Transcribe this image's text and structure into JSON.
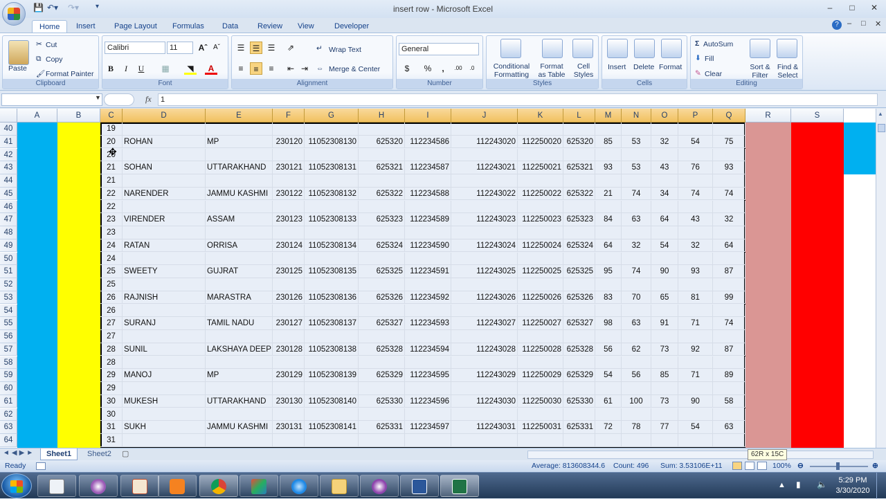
{
  "window": {
    "title": "insert row - Microsoft Excel"
  },
  "ribbon_tabs": [
    "Home",
    "Insert",
    "Page Layout",
    "Formulas",
    "Data",
    "Review",
    "View",
    "Developer"
  ],
  "clipboard": {
    "paste": "Paste",
    "cut": "Cut",
    "copy": "Copy",
    "format_painter": "Format Painter",
    "label": "Clipboard"
  },
  "font": {
    "name": "Calibri",
    "size": "11",
    "label": "Font",
    "bold": "B",
    "italic": "I",
    "underline": "U"
  },
  "alignment": {
    "wrap_text": "Wrap Text",
    "merge_center": "Merge & Center",
    "label": "Alignment"
  },
  "number": {
    "format": "General",
    "label": "Number",
    "currency": "$",
    "percent": "%",
    "comma": ","
  },
  "styles": {
    "conditional": "Conditional",
    "formatting": "Formatting",
    "format_as": "Format",
    "as_table": "as Table",
    "cell": "Cell",
    "styles_word": "Styles",
    "label": "Styles"
  },
  "cells": {
    "insert": "Insert",
    "delete": "Delete",
    "format": "Format",
    "label": "Cells"
  },
  "editing": {
    "autosum": "AutoSum",
    "fill": "Fill",
    "clear": "Clear",
    "sort": "Sort &",
    "filter": "Filter",
    "find": "Find &",
    "select": "Select",
    "label": "Editing"
  },
  "formula_bar": {
    "fx": "fx",
    "value": "1"
  },
  "columns": [
    "A",
    "B",
    "C",
    "D",
    "E",
    "F",
    "G",
    "H",
    "I",
    "J",
    "K",
    "L",
    "M",
    "N",
    "O",
    "P",
    "Q",
    "R",
    "S"
  ],
  "rows": [
    {
      "n": "40",
      "c": "19"
    },
    {
      "n": "41",
      "c": "20",
      "d": "ROHAN",
      "e": "MP",
      "f": "230120",
      "g": "11052308130",
      "h": "625320",
      "i": "112234586",
      "j": "112243020",
      "k": "112250020",
      "l": "625320",
      "m": "85",
      "nn": "53",
      "o": "32",
      "p": "54",
      "q": "75"
    },
    {
      "n": "42",
      "c": "20"
    },
    {
      "n": "43",
      "c": "21",
      "d": "SOHAN",
      "e": "UTTARAKHAND",
      "f": "230121",
      "g": "11052308131",
      "h": "625321",
      "i": "112234587",
      "j": "112243021",
      "k": "112250021",
      "l": "625321",
      "m": "93",
      "nn": "53",
      "o": "43",
      "p": "76",
      "q": "93"
    },
    {
      "n": "44",
      "c": "21"
    },
    {
      "n": "45",
      "c": "22",
      "d": "NARENDER",
      "e": "JAMMU KASHMI",
      "f": "230122",
      "g": "11052308132",
      "h": "625322",
      "i": "112234588",
      "j": "112243022",
      "k": "112250022",
      "l": "625322",
      "m": "21",
      "nn": "74",
      "o": "34",
      "p": "74",
      "q": "74"
    },
    {
      "n": "46",
      "c": "22"
    },
    {
      "n": "47",
      "c": "23",
      "d": "VIRENDER",
      "e": "ASSAM",
      "f": "230123",
      "g": "11052308133",
      "h": "625323",
      "i": "112234589",
      "j": "112243023",
      "k": "112250023",
      "l": "625323",
      "m": "84",
      "nn": "63",
      "o": "64",
      "p": "43",
      "q": "32"
    },
    {
      "n": "48",
      "c": "23"
    },
    {
      "n": "49",
      "c": "24",
      "d": "RATAN",
      "e": "ORRISA",
      "f": "230124",
      "g": "11052308134",
      "h": "625324",
      "i": "112234590",
      "j": "112243024",
      "k": "112250024",
      "l": "625324",
      "m": "64",
      "nn": "32",
      "o": "54",
      "p": "32",
      "q": "64"
    },
    {
      "n": "50",
      "c": "24"
    },
    {
      "n": "51",
      "c": "25",
      "d": "SWEETY",
      "e": "GUJRAT",
      "f": "230125",
      "g": "11052308135",
      "h": "625325",
      "i": "112234591",
      "j": "112243025",
      "k": "112250025",
      "l": "625325",
      "m": "95",
      "nn": "74",
      "o": "90",
      "p": "93",
      "q": "87"
    },
    {
      "n": "52",
      "c": "25"
    },
    {
      "n": "53",
      "c": "26",
      "d": "RAJNISH",
      "e": "MARASTRA",
      "f": "230126",
      "g": "11052308136",
      "h": "625326",
      "i": "112234592",
      "j": "112243026",
      "k": "112250026",
      "l": "625326",
      "m": "83",
      "nn": "70",
      "o": "65",
      "p": "81",
      "q": "99"
    },
    {
      "n": "54",
      "c": "26"
    },
    {
      "n": "55",
      "c": "27",
      "d": "SURANJ",
      "e": "TAMIL NADU",
      "f": "230127",
      "g": "11052308137",
      "h": "625327",
      "i": "112234593",
      "j": "112243027",
      "k": "112250027",
      "l": "625327",
      "m": "98",
      "nn": "63",
      "o": "91",
      "p": "71",
      "q": "74"
    },
    {
      "n": "56",
      "c": "27"
    },
    {
      "n": "57",
      "c": "28",
      "d": "SUNIL",
      "e": "LAKSHAYA DEEP",
      "f": "230128",
      "g": "11052308138",
      "h": "625328",
      "i": "112234594",
      "j": "112243028",
      "k": "112250028",
      "l": "625328",
      "m": "56",
      "nn": "62",
      "o": "73",
      "p": "92",
      "q": "87"
    },
    {
      "n": "58",
      "c": "28"
    },
    {
      "n": "59",
      "c": "29",
      "d": "MANOJ",
      "e": "MP",
      "f": "230129",
      "g": "11052308139",
      "h": "625329",
      "i": "112234595",
      "j": "112243029",
      "k": "112250029",
      "l": "625329",
      "m": "54",
      "nn": "56",
      "o": "85",
      "p": "71",
      "q": "89"
    },
    {
      "n": "60",
      "c": "29"
    },
    {
      "n": "61",
      "c": "30",
      "d": "MUKESH",
      "e": "UTTARAKHAND",
      "f": "230130",
      "g": "11052308140",
      "h": "625330",
      "i": "112234596",
      "j": "112243030",
      "k": "112250030",
      "l": "625330",
      "m": "61",
      "nn": "100",
      "o": "73",
      "p": "90",
      "q": "58"
    },
    {
      "n": "62",
      "c": "30"
    },
    {
      "n": "63",
      "c": "31",
      "d": "SUKH",
      "e": "JAMMU KASHMI",
      "f": "230131",
      "g": "11052308141",
      "h": "625331",
      "i": "112234597",
      "j": "112243031",
      "k": "112250031",
      "l": "625331",
      "m": "72",
      "nn": "78",
      "o": "77",
      "p": "54",
      "q": "63"
    },
    {
      "n": "64",
      "c": "31"
    }
  ],
  "sheet_tabs": [
    "Sheet1",
    "Sheet2"
  ],
  "selection_tip": "62R x 15C",
  "status": {
    "ready": "Ready",
    "average": "Average: 813608344.6",
    "count": "Count: 496",
    "sum": "Sum: 3.53106E+11",
    "zoom": "100%"
  },
  "clock": {
    "time": "5:29 PM",
    "date": "3/30/2020"
  },
  "colors": {
    "col_a": "#00b0f0",
    "col_b": "#ffff00",
    "col_r": "#da9694",
    "col_s": "#ff0000",
    "selection": "#e8eef7"
  }
}
